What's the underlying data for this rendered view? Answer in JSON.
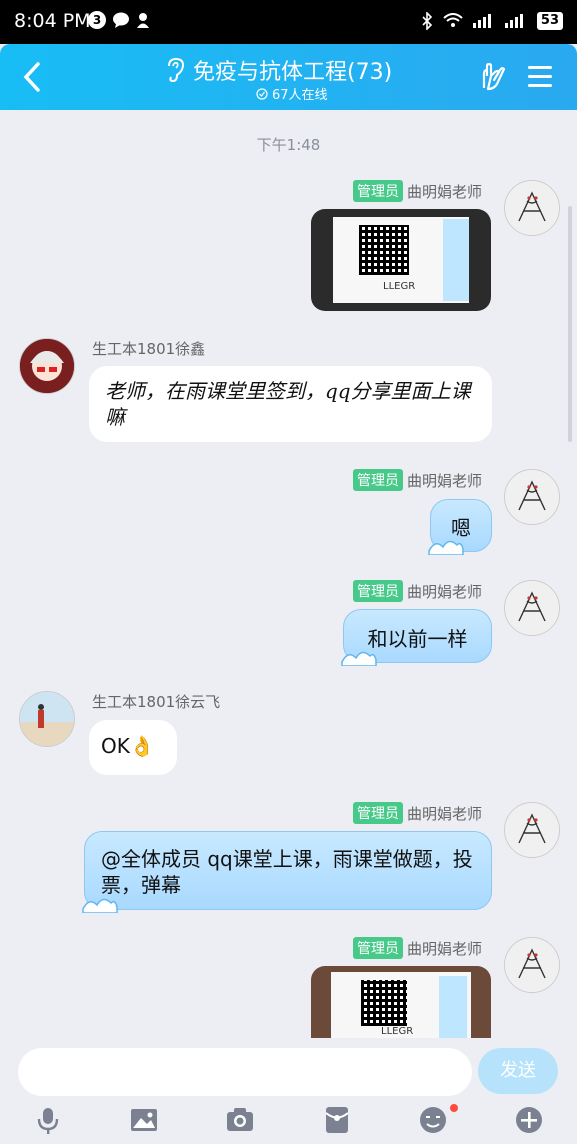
{
  "status_bar": {
    "time": "8:04 PM",
    "notif_count": "3",
    "battery": "53"
  },
  "header": {
    "title": "免疫与抗体工程(73)",
    "online": "67人在线"
  },
  "timestamp": "下午1:48",
  "messages": [
    {
      "sender": "曲明娟老师",
      "badge": "管理员",
      "type": "image",
      "caption": "LLEGR"
    },
    {
      "sender": "生工本1801徐鑫",
      "type": "text",
      "text": "老师，在雨课堂里签到，qq分享里面上课嘛"
    },
    {
      "sender": "曲明娟老师",
      "badge": "管理员",
      "type": "text",
      "text": "嗯"
    },
    {
      "sender": "曲明娟老师",
      "badge": "管理员",
      "type": "text",
      "text": "和以前一样"
    },
    {
      "sender": "生工本1801徐云飞",
      "type": "text",
      "text": "OK👌"
    },
    {
      "sender": "曲明娟老师",
      "badge": "管理员",
      "type": "text",
      "text": "@全体成员 qq课堂上课，雨课堂做题，投票，弹幕"
    },
    {
      "sender": "曲明娟老师",
      "badge": "管理员",
      "type": "image",
      "caption": "LLEGR"
    }
  ],
  "input": {
    "send_label": "发送"
  },
  "toolbar": {
    "icons": [
      "microphone-icon",
      "image-icon",
      "camera-icon",
      "red-packet-icon",
      "emoji-icon",
      "plus-icon"
    ]
  },
  "colors": {
    "header": "#18bdf5",
    "badge": "#47c98a",
    "bubble_blue": "#a9d9ff"
  }
}
